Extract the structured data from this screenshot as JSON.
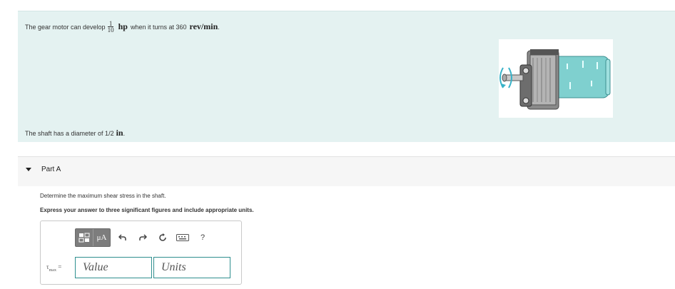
{
  "problem": {
    "intro_prefix": "The gear motor can develop",
    "fraction_num": "1",
    "fraction_den": "10",
    "power_unit": "hp",
    "intro_middle": "when it turns at 360",
    "speed_unit": "rev/min",
    "intro_end": ".",
    "shaft_prefix": "The shaft has a diameter of 1/2",
    "shaft_unit": "in",
    "shaft_end": "."
  },
  "part": {
    "title": "Part A",
    "question": "Determine the maximum shear stress in the shaft.",
    "instruction": "Express your answer to three significant figures and include appropriate units."
  },
  "toolbar": {
    "units_symbol": "μA",
    "help_label": "?"
  },
  "answer": {
    "variable": "τ",
    "subscript": "max",
    "equals": "=",
    "value_placeholder": "Value",
    "units_placeholder": "Units"
  }
}
